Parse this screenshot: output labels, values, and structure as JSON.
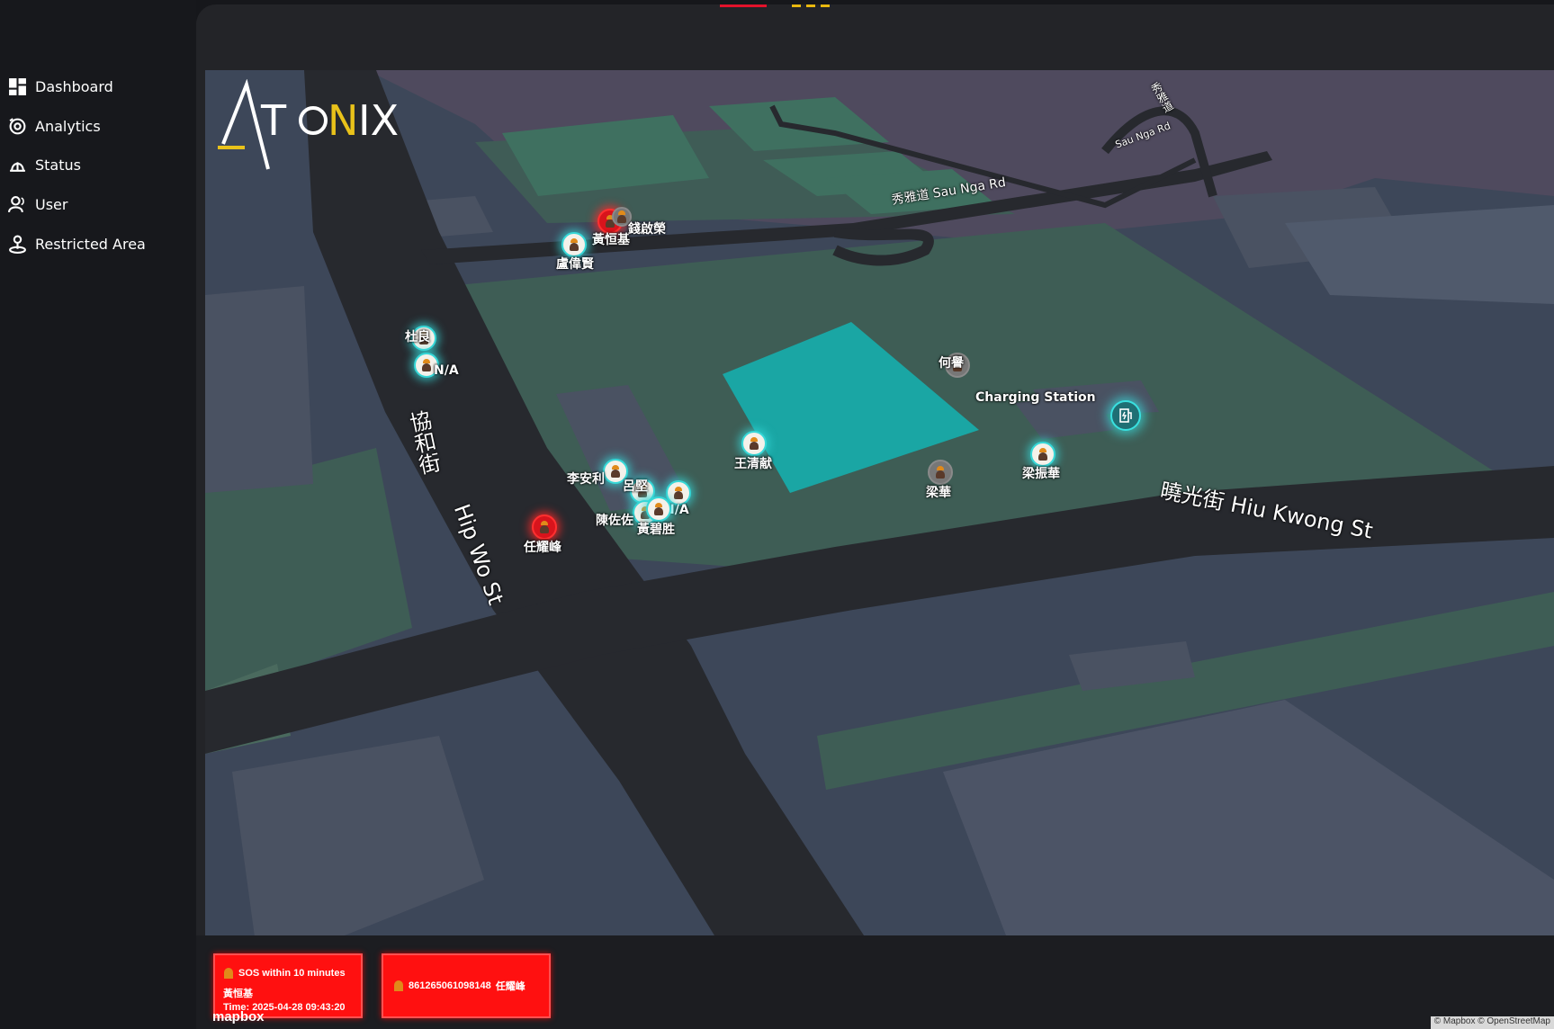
{
  "sidebar": {
    "items": [
      {
        "label": "Dashboard",
        "icon": "dashboard-icon"
      },
      {
        "label": "Analytics",
        "icon": "analytics-icon"
      },
      {
        "label": "Status",
        "icon": "status-icon"
      },
      {
        "label": "User",
        "icon": "user-icon"
      },
      {
        "label": "Restricted Area",
        "icon": "restricted-area-icon"
      }
    ]
  },
  "logo": {
    "text_a": "A",
    "text_rest_1": "T",
    "text_o": "O",
    "text_rest_2": "NIX"
  },
  "map": {
    "streets": {
      "sau_nga": "秀雅道 Sau Nga Rd",
      "hiu_kwong": "曉光街 Hiu Kwong St",
      "hip_wo_cn": "協和街",
      "hip_wo_en": "Hip Wo St",
      "top_right_cn": "秀雅道",
      "top_right_en": "Sau Nga Rd"
    },
    "workers": [
      {
        "name": "黃恒基",
        "status": "sos"
      },
      {
        "name": "錢啟榮",
        "status": "offline"
      },
      {
        "name": "盧偉賢",
        "status": "online"
      },
      {
        "name": "杜良",
        "status": "online"
      },
      {
        "name": "N/A",
        "status": "online"
      },
      {
        "name": "何譽",
        "status": "offline"
      },
      {
        "name": "王清献",
        "status": "online"
      },
      {
        "name": "李安利",
        "status": "online"
      },
      {
        "name": "呂堅",
        "status": "online"
      },
      {
        "name": "N/A",
        "status": "online"
      },
      {
        "name": "陳佐佐",
        "status": "online"
      },
      {
        "name": "黃碧胜",
        "status": "online"
      },
      {
        "name": "任耀峰",
        "status": "sos"
      },
      {
        "name": "梁華",
        "status": "offline"
      },
      {
        "name": "梁振華",
        "status": "online"
      }
    ],
    "charging_station": {
      "label": "Charging Station"
    }
  },
  "alerts": [
    {
      "title": "SOS within 10 minutes",
      "name": "黃恒基",
      "time": "Time: 2025-04-28 09:43:20"
    },
    {
      "device": "861265061098148",
      "name": "任耀峰"
    }
  ],
  "footer": {
    "mapbox": "mapbox",
    "attribution": "© Mapbox © OpenStreetMap"
  },
  "colors": {
    "accent": "#36d7d7",
    "sos": "#ff1010",
    "sidebar": "#17181c",
    "panel": "#232428"
  }
}
